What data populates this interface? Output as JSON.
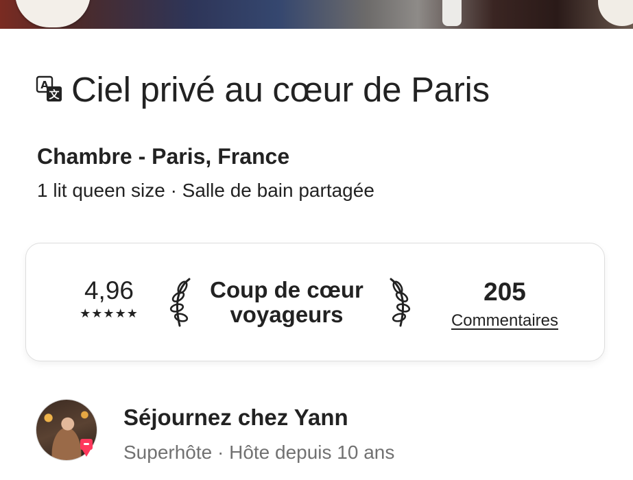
{
  "listing": {
    "title": "Ciel privé au cœur de Paris",
    "subtitle": "Chambre - Paris, France",
    "details": "1 lit queen size · Salle de bain partagée"
  },
  "stats": {
    "rating": "4,96",
    "stars": "★★★★★",
    "star_count": 5,
    "favorite_line1": "Coup de cœur",
    "favorite_line2": "voyageurs",
    "reviews_count": "205",
    "reviews_label": "Commentaires"
  },
  "host": {
    "name": "Séjournez chez Yann",
    "meta": "Superhôte · Hôte depuis 10 ans"
  },
  "icons": {
    "translate": "translate-icon",
    "laurel_left": "laurel-left-icon",
    "laurel_right": "laurel-right-icon",
    "superhost": "superhost-badge-icon"
  },
  "colors": {
    "text": "#222222",
    "muted": "#717171",
    "border": "#dddddd",
    "brand": "#ff385c"
  }
}
